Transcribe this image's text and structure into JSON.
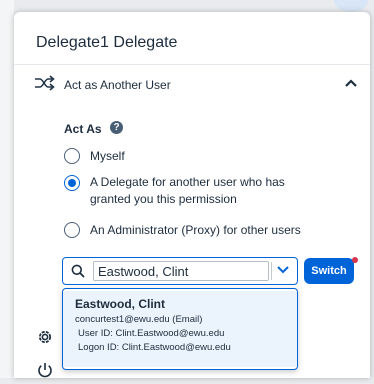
{
  "panel": {
    "title": "Delegate1 Delegate",
    "act_as_another_user": "Act as Another User",
    "act_as_label": "Act As",
    "help_glyph": "?",
    "options": [
      {
        "line1": "Myself",
        "line2": "",
        "checked": false
      },
      {
        "line1": "A Delegate for another user who has",
        "line2": "granted you this permission",
        "checked": true
      },
      {
        "line1": "An Administrator (Proxy) for other users",
        "line2": "",
        "checked": false
      }
    ],
    "search_value": "Eastwood, Clint",
    "switch_label": "Switch"
  },
  "suggestion": {
    "name": "Eastwood, Clint",
    "email": "concurtest1@ewu.edu (Email)",
    "user_id": "User ID: Clint.Eastwood@ewu.edu",
    "logon_id": "Logon ID: Clint.Eastwood@ewu.edu"
  },
  "colors": {
    "accent": "#0064d9",
    "text": "#1d2d3e",
    "alert": "#d9364c"
  },
  "icons": [
    "shuffle-icon",
    "chevron-up-icon",
    "help-icon",
    "search-icon",
    "chevron-down-icon",
    "gear-icon",
    "power-icon"
  ]
}
